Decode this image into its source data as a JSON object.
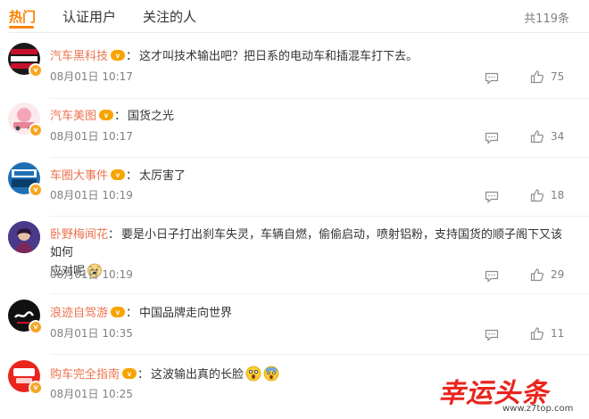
{
  "tabs": [
    {
      "label": "热门",
      "active": true
    },
    {
      "label": "认证用户",
      "active": false
    },
    {
      "label": "关注的人",
      "active": false
    }
  ],
  "total_label": "共119条",
  "colors": {
    "accent": "#ff8200",
    "username": "#eb7350",
    "meta": "#808080"
  },
  "comments": [
    {
      "user": "汽车黑科技",
      "text": "这才叫技术输出吧？把日系的电动车和插混车打下去。",
      "time": "08月01日 10:17",
      "likes": "75",
      "avatar_icon": "car-blacktech-logo"
    },
    {
      "user": "汽车美图",
      "text": "国货之光",
      "time": "08月01日 10:17",
      "likes": "34",
      "avatar_icon": "car-photo-logo"
    },
    {
      "user": "车圈大事件",
      "text": "太厉害了",
      "time": "08月01日 10:19",
      "likes": "18",
      "avatar_icon": "car-events-logo"
    },
    {
      "user": "卧野梅闻花",
      "text": "要是小日子打出刹车失灵，车辆自燃，偷偷启动，喷射铝粉，支持国货的顺子阁下又该如何",
      "text_line2": "应对呢",
      "time": "08月01日 10:19",
      "likes": "29",
      "avatar_icon": "purple-portrait-avatar",
      "emoji": "doge-emoji"
    },
    {
      "user": "浪迹自驾游",
      "text": "中国品牌走向世界",
      "time": "08月01日 10:35",
      "likes": "11",
      "avatar_icon": "langji-logo"
    },
    {
      "user": "购车完全指南",
      "text": "这波输出真的长脸",
      "time": "08月01日 10:25",
      "likes": "",
      "avatar_icon": "car-guide-logo",
      "emoji": "shocked-emoji,scream-emoji"
    }
  ],
  "watermark": {
    "title": "幸运头条",
    "url": "www.z7top.com"
  }
}
